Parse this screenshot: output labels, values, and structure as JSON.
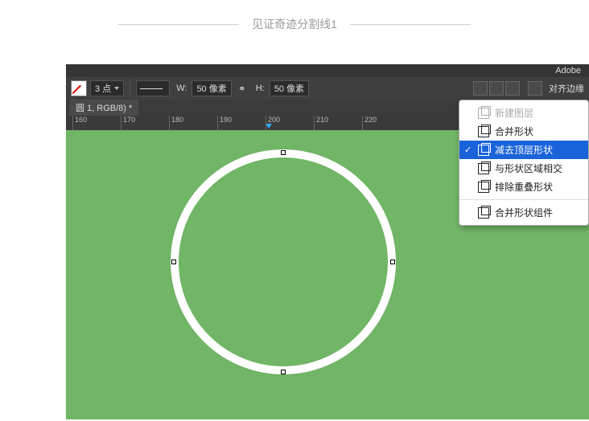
{
  "divider": {
    "text": "见证奇迹分割线1"
  },
  "app_brand": "Adobe",
  "toolbar": {
    "stroke_weight": "3 点",
    "w_label": "W:",
    "w_value": "50 像素",
    "h_label": "H:",
    "h_value": "50 像素",
    "align_label": "对齐边缘"
  },
  "tab": {
    "label": "圆 1, RGB/8) *"
  },
  "ruler": {
    "ticks": [
      "160",
      "170",
      "180",
      "190",
      "200",
      "210",
      "220"
    ]
  },
  "menu": {
    "items": [
      {
        "label": "新建图层",
        "disabled": true
      },
      {
        "label": "合并形状"
      },
      {
        "label": "减去顶层形状",
        "selected": true
      },
      {
        "label": "与形状区域相交"
      },
      {
        "label": "排除重叠形状"
      }
    ],
    "footer": {
      "label": "合并形状组件"
    }
  }
}
